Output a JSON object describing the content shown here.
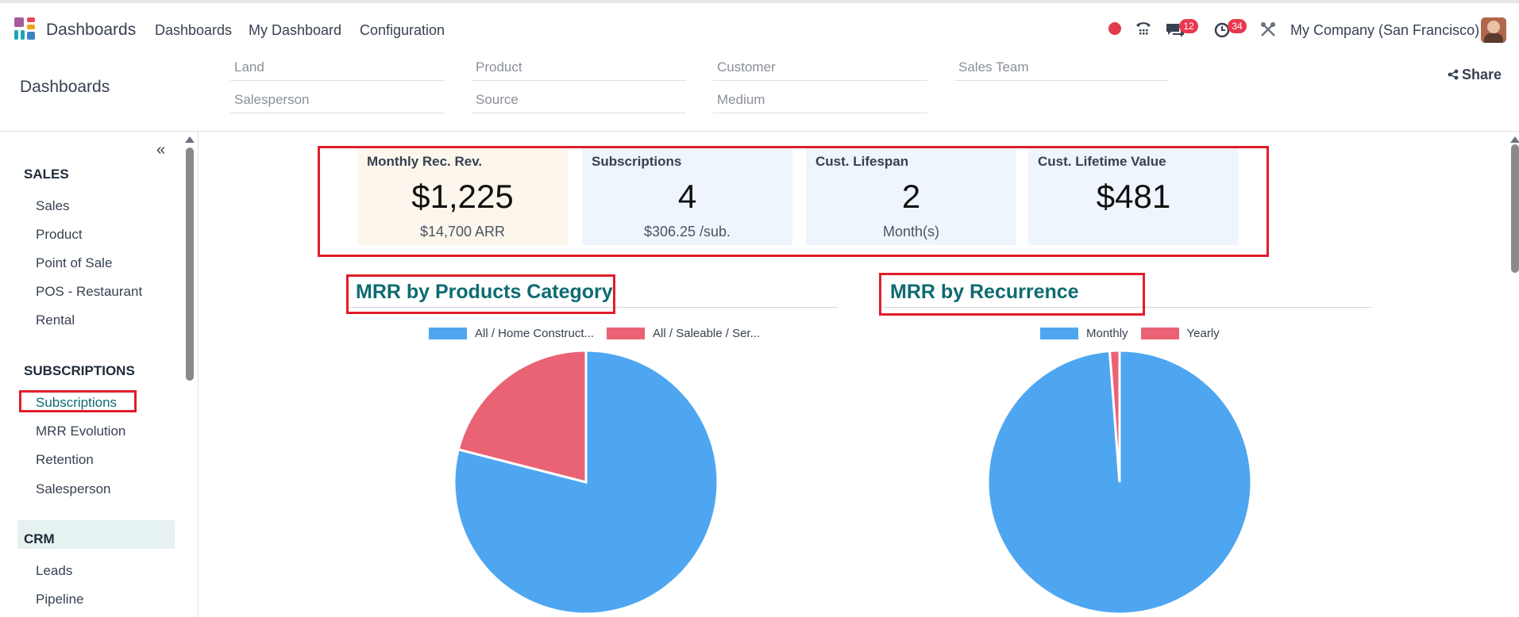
{
  "navbar": {
    "app_name": "Dashboards",
    "menu": [
      "Dashboards",
      "My Dashboard",
      "Configuration"
    ],
    "messages_badge": "12",
    "activities_badge": "34",
    "company": "My Company (San Francisco)"
  },
  "control_panel": {
    "breadcrumb": "Dashboards",
    "filters": [
      "Land",
      "Product",
      "Customer",
      "Sales Team",
      "Salesperson",
      "Source",
      "Medium"
    ],
    "share_label": "Share"
  },
  "sidebar": {
    "collapse_icon": "«",
    "sections": [
      {
        "title": "SALES",
        "items": [
          "Sales",
          "Product",
          "Point of Sale",
          "POS - Restaurant",
          "Rental"
        ]
      },
      {
        "title": "SUBSCRIPTIONS",
        "items": [
          "Subscriptions",
          "MRR Evolution",
          "Retention",
          "Salesperson"
        ]
      },
      {
        "title": "CRM",
        "items": [
          "Leads",
          "Pipeline"
        ]
      }
    ],
    "active_item": "Subscriptions"
  },
  "kpis": [
    {
      "title": "Monthly Rec. Rev.",
      "value": "$1,225",
      "sub": "$14,700 ARR",
      "bg": "#fdf6ec"
    },
    {
      "title": "Subscriptions",
      "value": "4",
      "sub": "$306.25 /sub.",
      "bg": "#eef5fd"
    },
    {
      "title": "Cust. Lifespan",
      "value": "2",
      "sub": "Month(s)",
      "bg": "#eef5fd"
    },
    {
      "title": "Cust. Lifetime Value",
      "value": "$481",
      "sub": "",
      "bg": "#eef5fd"
    }
  ],
  "colors": {
    "blue": "#4ea6f1",
    "red": "#e96374",
    "teal": "#0e6b72",
    "highlight": "#e11d2a"
  },
  "chart_data": [
    {
      "type": "pie",
      "title": "MRR by Products Category",
      "categories": [
        "All / Home Construct...",
        "All / Saleable / Ser..."
      ],
      "values": [
        79,
        21
      ],
      "colors": [
        "#4ea6f1",
        "#e96374"
      ],
      "legend": "top"
    },
    {
      "type": "pie",
      "title": "MRR by Recurrence",
      "categories": [
        "Monthly",
        "Yearly"
      ],
      "values": [
        98.8,
        1.2
      ],
      "colors": [
        "#4ea6f1",
        "#e96374"
      ],
      "legend": "top"
    }
  ]
}
